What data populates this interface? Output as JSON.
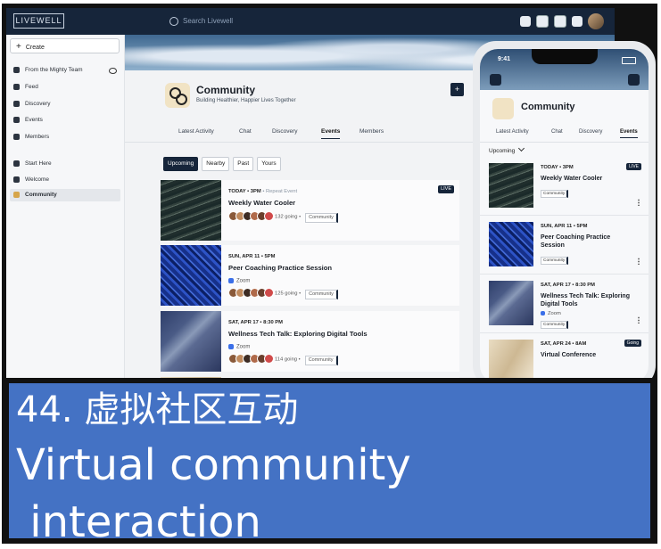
{
  "app": {
    "logo_text": "LIVEWELL",
    "search_placeholder": "Search Livewell"
  },
  "sidebar": {
    "create_label": "Create",
    "items": [
      {
        "label": "From the Mighty Team",
        "icon": "megaphone-icon"
      },
      {
        "label": "Feed",
        "icon": "feed-icon"
      },
      {
        "label": "Discovery",
        "icon": "compass-icon"
      },
      {
        "label": "Events",
        "icon": "calendar-icon"
      },
      {
        "label": "Members",
        "icon": "people-icon"
      },
      {
        "label": "Start Here",
        "icon": "caret-icon"
      },
      {
        "label": "Welcome",
        "icon": "globe-icon"
      },
      {
        "label": "Community",
        "icon": "community-icon"
      }
    ]
  },
  "community": {
    "title": "Community",
    "subtitle": "Building Healthier, Happier Lives Together",
    "add_label": "+",
    "tabs": [
      "Latest Activity",
      "Chat",
      "Discovery",
      "Events",
      "Members"
    ],
    "active_tab": "Events"
  },
  "filters": [
    "Upcoming",
    "Nearby",
    "Past",
    "Yours"
  ],
  "events": [
    {
      "date": "TODAY • 3PM",
      "repeat": "• Repeat Event",
      "name": "Weekly Water Cooler",
      "location": "",
      "going": "132 going",
      "tag": "Community",
      "badge": "LIVE"
    },
    {
      "date": "SUN, APR 11 • 5PM",
      "repeat": "",
      "name": "Peer Coaching Practice Session",
      "location": "Zoom",
      "going": "125 going",
      "tag": "Community",
      "badge": ""
    },
    {
      "date": "SAT, APR 17  •  8:30 PM",
      "repeat": "",
      "name": "Wellness Tech Talk: Exploring Digital Tools",
      "location": "Zoom",
      "going": "114 going",
      "tag": "Community",
      "badge": ""
    }
  ],
  "phone": {
    "time": "9:41",
    "title": "Community",
    "tabs": [
      "Latest Activity",
      "Chat",
      "Discovery",
      "Events"
    ],
    "filter_label": "Upcoming",
    "events": [
      {
        "date": "TODAY • 3PM",
        "name": "Weekly Water Cooler",
        "location": "",
        "tag": "Community",
        "badge": "LIVE"
      },
      {
        "date": "SUN, APR 11 • 5PM",
        "name": "Peer Coaching Practice Session",
        "location": "",
        "tag": "Community",
        "badge": ""
      },
      {
        "date": "SAT, APR 17  •  8:30 PM",
        "name": "Wellness Tech Talk: Exploring Digital Tools",
        "location": "Zoom",
        "tag": "Community",
        "badge": ""
      },
      {
        "date": "SAT, APR 24 • 8AM",
        "name": "Virtual Conference",
        "location": "",
        "tag": "",
        "badge": "Going"
      }
    ]
  },
  "caption": {
    "line1": "44. 虚拟社区互动",
    "line2": "Virtual community",
    "line3": " interaction"
  },
  "colors": {
    "navy": "#16253a",
    "caption_blue": "#4472c4"
  }
}
